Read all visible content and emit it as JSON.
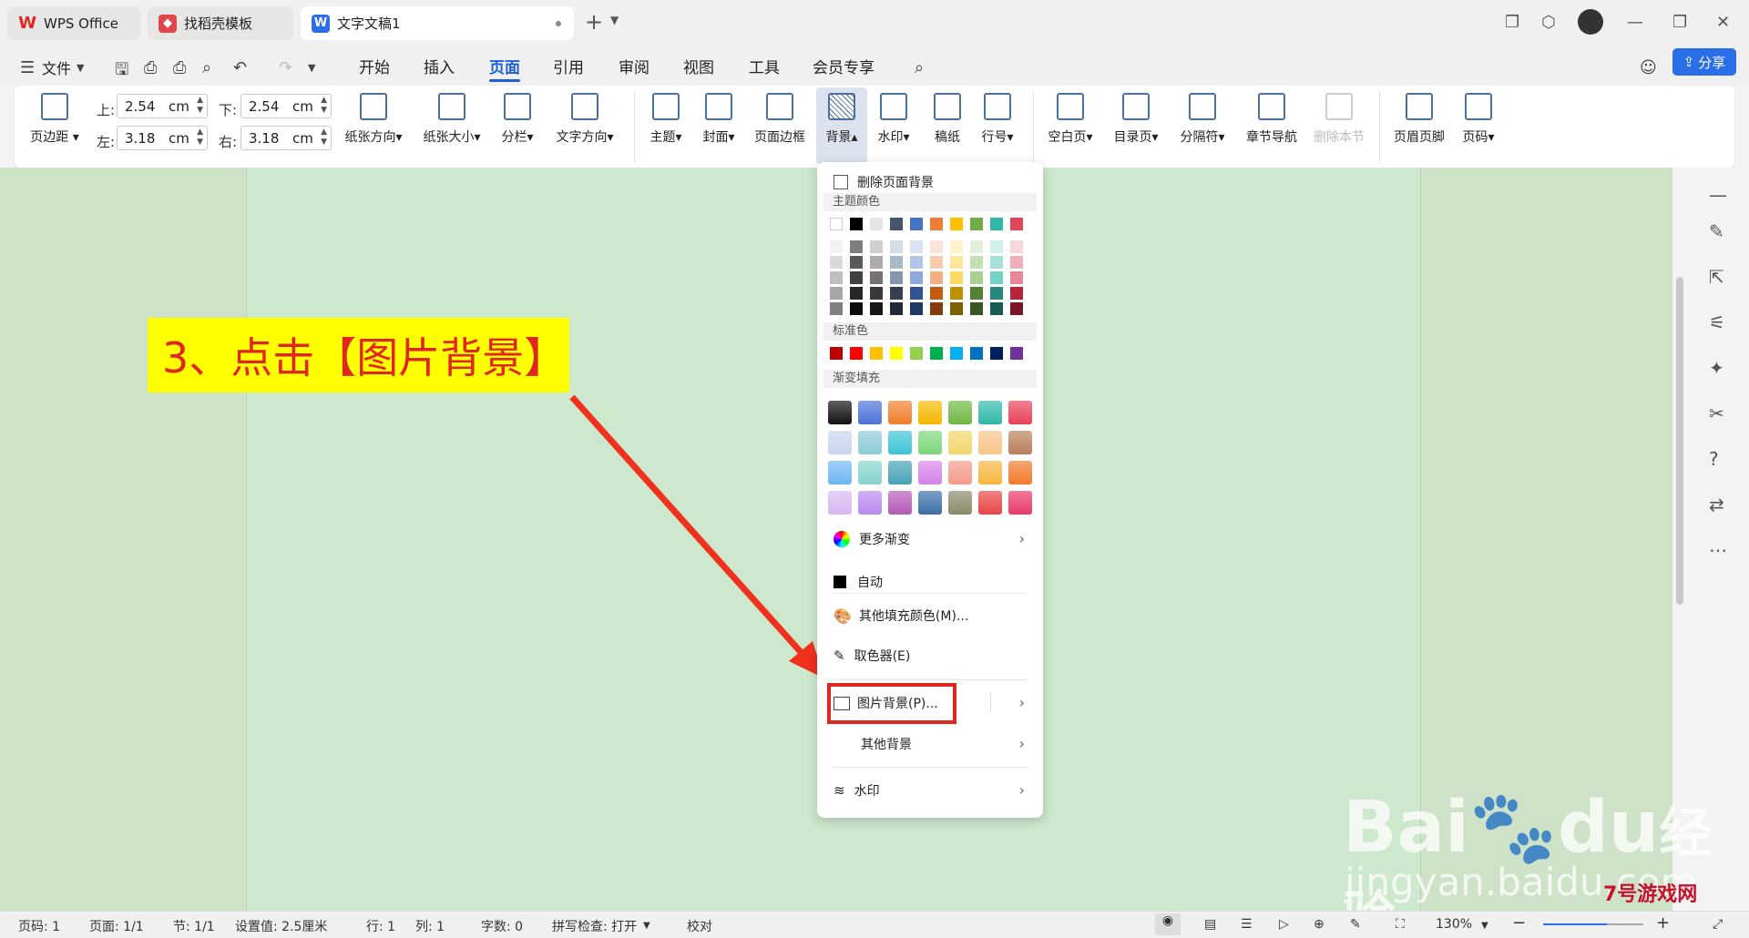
{
  "tabs": [
    {
      "label": "WPS Office"
    },
    {
      "label": "找稻壳模板"
    },
    {
      "label": "文字文稿1"
    }
  ],
  "menu": {
    "file": "文件",
    "items": [
      "开始",
      "插入",
      "页面",
      "引用",
      "审阅",
      "视图",
      "工具",
      "会员专享"
    ],
    "active": "页面",
    "share": "分享"
  },
  "ribbon": {
    "margins_label": "页边距",
    "top_label": "上:",
    "top_value": "2.54",
    "bottom_label": "下:",
    "bottom_value": "2.54",
    "left_label": "左:",
    "left_value": "3.18",
    "right_label": "右:",
    "right_value": "3.18",
    "unit": "cm",
    "orientation": "纸张方向",
    "size": "纸张大小",
    "columns": "分栏",
    "text_direction": "文字方向",
    "theme": "主题",
    "cover": "封面",
    "page_border": "页面边框",
    "background": "背景",
    "watermark": "水印",
    "manuscript": "稿纸",
    "line_number": "行号",
    "blank_page": "空白页",
    "toc_page": "目录页",
    "separator": "分隔符",
    "section_nav": "章节导航",
    "delete_section": "删除本节",
    "header_footer": "页眉页脚",
    "page_number": "页码"
  },
  "dropdown": {
    "delete_bg": "删除页面背景",
    "theme_colors": "主题颜色",
    "standard_colors": "标准色",
    "gradient_fill": "渐变填充",
    "more_gradient": "更多渐变",
    "auto": "自动",
    "other_fill": "其他填充颜色(M)...",
    "eyedropper": "取色器(E)",
    "picture_bg": "图片背景(P)...",
    "other_bg": "其他背景",
    "watermark": "水印",
    "theme_top_row": [
      "#ffffff",
      "#000000",
      "#e7e6e6",
      "#44546a",
      "#4472c4",
      "#ed7d31",
      "#ffc000",
      "#70ad47",
      "#2fb8a8",
      "#e0465a"
    ],
    "theme_shades": [
      [
        "#f2f2f2",
        "#7f7f7f",
        "#d0cece",
        "#d6dce4",
        "#d9e1f2",
        "#fbe4d5",
        "#fff2cc",
        "#e2efda",
        "#d1f0ec",
        "#f8d7dc"
      ],
      [
        "#d9d9d9",
        "#595959",
        "#aeaaaa",
        "#acb9ca",
        "#b4c6e7",
        "#f8cbad",
        "#ffe699",
        "#c6e0b4",
        "#a3e1d9",
        "#f1aeb8"
      ],
      [
        "#bfbfbf",
        "#404040",
        "#757171",
        "#8497b0",
        "#8ea9db",
        "#f4b084",
        "#ffd966",
        "#a9d08e",
        "#75d2c6",
        "#ea8596"
      ],
      [
        "#a6a6a6",
        "#262626",
        "#3a3838",
        "#333f4f",
        "#2f5597",
        "#c55a11",
        "#bf8f00",
        "#548235",
        "#228a7e",
        "#b8233a"
      ],
      [
        "#808080",
        "#0d0d0d",
        "#171616",
        "#222a35",
        "#1f3864",
        "#843c0c",
        "#7f6000",
        "#375623",
        "#175c54",
        "#7a1727"
      ]
    ],
    "standard": [
      "#c00000",
      "#ff0000",
      "#ffc000",
      "#ffff00",
      "#92d050",
      "#00b050",
      "#00b0f0",
      "#0070c0",
      "#002060",
      "#7030a0"
    ],
    "gradients": [
      [
        "#111111",
        "#4a72d8",
        "#ef7f2b",
        "#f5b800",
        "#6fb843",
        "#2fb8a8",
        "#e8425a"
      ],
      [
        "#c9d4ee",
        "#8ecbd6",
        "#3cc4d6",
        "#7dd67a",
        "#f3d66a",
        "#f8c48a",
        "#b88058"
      ],
      [
        "#6fb6f2",
        "#88d3cc",
        "#46a2b5",
        "#d682e8",
        "#f59a8a",
        "#f8b640",
        "#f27a2a"
      ],
      [
        "#d8b8f2",
        "#b98af0",
        "#b45ab8",
        "#3a6ea8",
        "#8a8a6a",
        "#e84545",
        "#e83a6a"
      ]
    ]
  },
  "annotation": {
    "callout": "3、点击【图片背景】"
  },
  "status": {
    "page_num": "页码: 1",
    "pages": "页面: 1/1",
    "section": "节: 1/1",
    "setting": "设置值: 2.5厘米",
    "row": "行: 1",
    "col": "列: 1",
    "words": "字数: 0",
    "spell": "拼写检查: 打开",
    "proof": "校对",
    "zoom": "130%"
  },
  "watermark": {
    "brand": "Bai",
    "brand2": "du",
    "cn": "经验",
    "url": "jingyan.baidu.com",
    "site": "7号游戏网"
  },
  "colors": {
    "accent": "#1d5fd6",
    "doc_bg": "#cde8cc",
    "callout_bg": "#ffff00",
    "callout_text": "#e0261e"
  }
}
